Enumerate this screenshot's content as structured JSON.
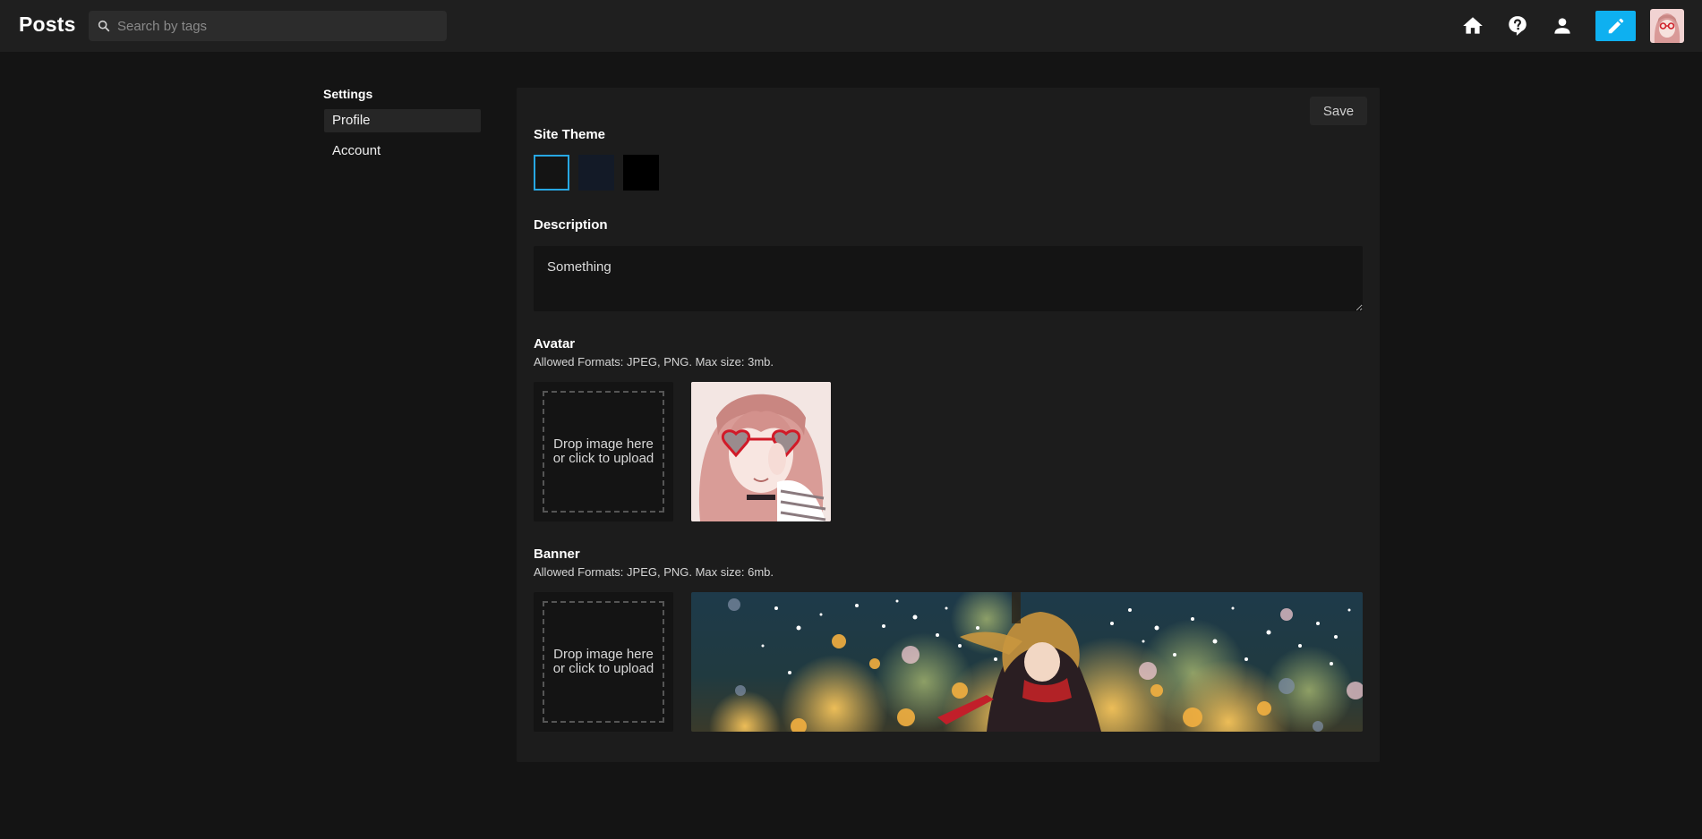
{
  "header": {
    "brand": "Posts",
    "search_placeholder": "Search by tags",
    "icons": [
      "home-icon",
      "help-icon",
      "user-icon",
      "pencil-icon"
    ]
  },
  "sidebar": {
    "heading": "Settings",
    "items": [
      {
        "label": "Profile",
        "active": true
      },
      {
        "label": "Account",
        "active": false
      }
    ]
  },
  "form": {
    "save_label": "Save",
    "theme": {
      "title": "Site Theme",
      "options": [
        {
          "name": "dark",
          "color": "#141414",
          "selected": true
        },
        {
          "name": "navy",
          "color": "#131a27",
          "selected": false
        },
        {
          "name": "black",
          "color": "#000000",
          "selected": false
        }
      ]
    },
    "description": {
      "title": "Description",
      "value": "Something"
    },
    "avatar": {
      "title": "Avatar",
      "hint": "Allowed Formats: JPEG, PNG. Max size: 3mb.",
      "dropzone_text": "Drop image here\nor click to upload"
    },
    "banner": {
      "title": "Banner",
      "hint": "Allowed Formats: JPEG, PNG. Max size: 6mb.",
      "dropzone_text": "Drop image here\nor click to upload"
    }
  },
  "colors": {
    "accent": "#0eb0f0",
    "selected_border": "#27a7e3",
    "background": "#141414",
    "panel": "#1c1c1c"
  }
}
